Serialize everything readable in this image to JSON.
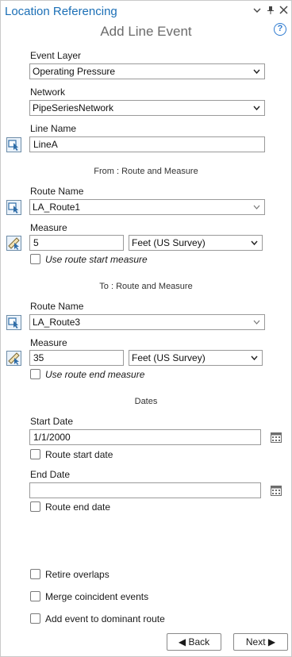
{
  "pane": {
    "title": "Location Referencing"
  },
  "panel": {
    "title": "Add Line Event",
    "help_glyph": "?"
  },
  "titlebar_icons": {
    "menu": "chevron-down-icon",
    "pin": "pin-icon",
    "close": "close-icon"
  },
  "event_layer": {
    "label": "Event Layer",
    "value": "Operating Pressure"
  },
  "network": {
    "label": "Network",
    "value": "PipeSeriesNetwork"
  },
  "line_name": {
    "label": "Line Name",
    "value": "LineA"
  },
  "from": {
    "section": "From : Route and Measure",
    "route_label": "Route Name",
    "route_value": "LA_Route1",
    "measure_label": "Measure",
    "measure_value": "5",
    "units_value": "Feet (US Survey)",
    "checkbox_label": "Use route start measure",
    "checked": false
  },
  "to": {
    "section": "To : Route and Measure",
    "route_label": "Route Name",
    "route_value": "LA_Route3",
    "measure_label": "Measure",
    "measure_value": "35",
    "units_value": "Feet (US Survey)",
    "checkbox_label": "Use route end measure",
    "checked": false
  },
  "dates": {
    "section": "Dates",
    "start_label": "Start Date",
    "start_value": "1/1/2000",
    "start_checkbox": "Route start date",
    "end_label": "End Date",
    "end_value": "",
    "end_checkbox": "Route end date"
  },
  "options": {
    "retire": "Retire overlaps",
    "merge": "Merge coincident events",
    "dominant": "Add event to dominant route"
  },
  "buttons": {
    "back": "◀ Back",
    "next": "Next ▶"
  },
  "colors": {
    "accent": "#1b6fb6",
    "help": "#2f7bd0"
  }
}
